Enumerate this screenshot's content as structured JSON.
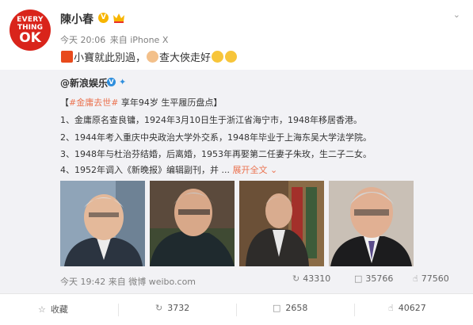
{
  "avatar": {
    "line1": "EVERY",
    "line2": "THING",
    "line3": "OK"
  },
  "author": {
    "name": "陳小春",
    "verified_mark": "V"
  },
  "meta": {
    "time": "今天 20:06",
    "source": "来自 iPhone X"
  },
  "post": {
    "text1": "小寶就此別過，",
    "text2": "查大俠走好"
  },
  "repost": {
    "author": "@新浪娱乐",
    "verified_mark": "V",
    "headline_prefix": "【",
    "headline_tag": "#金庸去世#",
    "headline_rest": " 享年94岁 生平履历盘点】",
    "lines": [
      "1、金庸原名查良镛，1924年3月10日生于浙江省海宁市，1948年移居香港。",
      "2、1944年考入重庆中央政治大学外交系，1948年毕业于上海东吴大学法学院。",
      "3、1948年与杜治芬结婚，后离婚，1953年再娶第二任妻子朱玫，生二子二女。",
      "4、1952年调入《新晚报》编辑副刊，并 ..."
    ],
    "expand": "展开全文",
    "time": "今天 19:42",
    "source": "来自 微博 weibo.com",
    "stats": {
      "reposts": "43310",
      "comments": "35766",
      "likes": "77560"
    }
  },
  "actions": {
    "favorite": "收藏",
    "repost": "3732",
    "comment": "2658",
    "like": "40627"
  },
  "colors": {
    "accent": "#eb7350",
    "brand_red": "#d9241b",
    "repost_bg": "#f2f2f5"
  }
}
